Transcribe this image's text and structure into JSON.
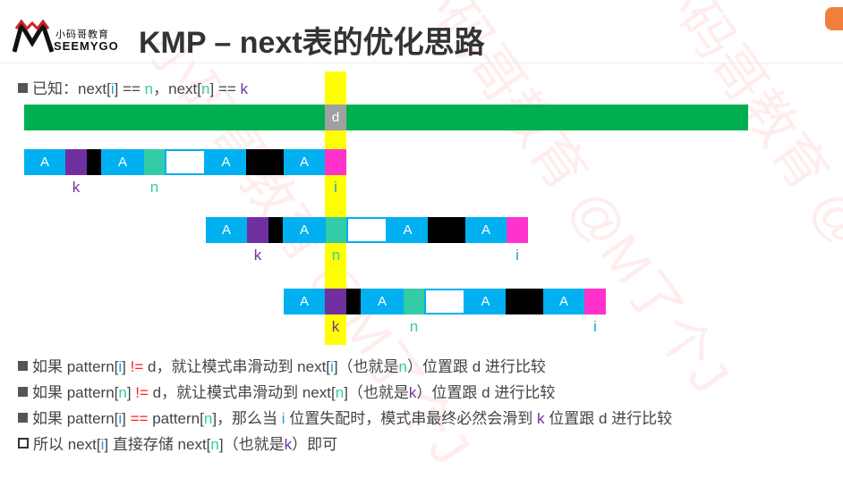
{
  "logo": {
    "cn": "小码哥教育",
    "en": "SEEMYGO"
  },
  "title": "KMP – next表的优化思路",
  "known": {
    "prefix": "已知：next[",
    "i": "i",
    "mid1": "] == ",
    "n1": "n",
    "mid2": "，next[",
    "n2": "n",
    "mid3": "] == ",
    "k": "k"
  },
  "diagram": {
    "text_label": "d",
    "cell_letter": "A",
    "cells": [
      "A",
      "purple",
      "black",
      "A",
      "teal",
      "white",
      "A",
      "black",
      "A",
      "pink"
    ],
    "colors": {
      "A": "#00b0f0",
      "purple": "#7030a0",
      "black": "#000000",
      "teal": "#33cca6",
      "white": "#ffffff",
      "pink": "#ff33cc",
      "green": "#00b050",
      "highlight": "#ffff00"
    },
    "rows": [
      {
        "labels": {
          "k": "k",
          "n": "n",
          "i": "i"
        }
      },
      {
        "labels": {
          "k": "k",
          "n": "n",
          "i": "i"
        }
      },
      {
        "labels": {
          "k": "k",
          "n": "n",
          "i": "i"
        }
      }
    ]
  },
  "bullets": [
    {
      "parts": [
        [
          "",
          "如果 pattern["
        ],
        [
          "ci",
          "i"
        ],
        [
          "",
          "] "
        ],
        [
          "cr",
          "!="
        ],
        [
          "",
          " d，就让模式串滑动到 next["
        ],
        [
          "ci",
          "i"
        ],
        [
          "",
          "]（也就是"
        ],
        [
          "cn",
          "n"
        ],
        [
          "",
          "）位置跟 d 进行比较"
        ]
      ]
    },
    {
      "parts": [
        [
          "",
          "如果 pattern["
        ],
        [
          "cn",
          "n"
        ],
        [
          "",
          "] "
        ],
        [
          "cr",
          "!="
        ],
        [
          "",
          " d，就让模式串滑动到 next["
        ],
        [
          "cn",
          "n"
        ],
        [
          "",
          "]（也就是"
        ],
        [
          "ck",
          "k"
        ],
        [
          "",
          "）位置跟 d 进行比较"
        ]
      ]
    },
    {
      "parts": [
        [
          "",
          "如果 pattern["
        ],
        [
          "ci",
          "i"
        ],
        [
          "",
          "] "
        ],
        [
          "cr",
          "=="
        ],
        [
          "",
          " pattern["
        ],
        [
          "cn",
          "n"
        ],
        [
          "",
          "]，那么当 "
        ],
        [
          "ci",
          "i"
        ],
        [
          "",
          " 位置失配时，模式串最终必然会滑到 "
        ],
        [
          "ck",
          "k"
        ],
        [
          "",
          " 位置跟 d 进行比较"
        ]
      ]
    },
    {
      "parts": [
        [
          "",
          "所以 next["
        ],
        [
          "ci",
          "i"
        ],
        [
          "",
          "] 直接存储 next["
        ],
        [
          "cn",
          "n"
        ],
        [
          "",
          "]（也就是"
        ],
        [
          "ck",
          "k"
        ],
        [
          "",
          "）即可"
        ]
      ]
    }
  ]
}
